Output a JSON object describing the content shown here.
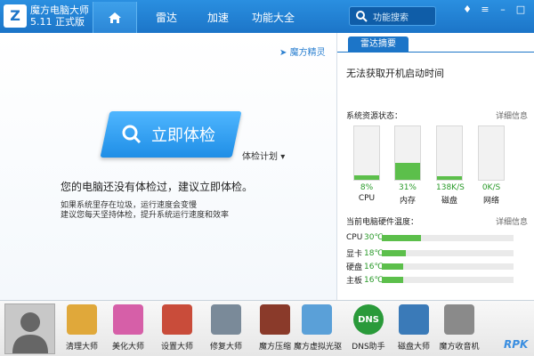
{
  "app": {
    "name": "魔方电脑大师",
    "version": "5.11 正式版"
  },
  "nav": {
    "tabs": [
      "雷达",
      "加速",
      "功能大全"
    ],
    "search_placeholder": "功能搜索"
  },
  "left": {
    "sprite_label": "魔方精灵",
    "check_button": "立即体检",
    "plan_label": "体检计划",
    "message": "您的电脑还没有体检过，建议立即体检。",
    "tip1": "如果系统里存在垃圾，运行速度会变慢",
    "tip2": "建议您每天坚持体检，提升系统运行速度和效率"
  },
  "right": {
    "tab": "雷达摘要",
    "boot_time": "无法获取开机启动时间",
    "resource_header": "系统资源状态：",
    "detail_link": "详细信息",
    "resources": [
      {
        "label": "CPU",
        "value": "8%",
        "level": 0.08
      },
      {
        "label": "内存",
        "value": "31%",
        "level": 0.31
      },
      {
        "label": "磁盘",
        "value": "138K/S",
        "level": 0.06
      },
      {
        "label": "网络",
        "value": "0K/S",
        "level": 0.0
      }
    ],
    "temp_header": "当前电脑硬件温度：",
    "temps": [
      {
        "name": "CPU",
        "value": "30℃",
        "level": 0.3
      },
      {
        "name": "显卡",
        "value": "18℃",
        "level": 0.18
      },
      {
        "name": "硬盘",
        "value": "16℃",
        "level": 0.16
      },
      {
        "name": "主板",
        "value": "16℃",
        "level": 0.16
      }
    ]
  },
  "tools": [
    {
      "label": "清理大师",
      "icon": "broom-icon",
      "color": "#e0a83a"
    },
    {
      "label": "美化大师",
      "icon": "brush-icon",
      "color": "#d65fa8"
    },
    {
      "label": "设置大师",
      "icon": "rocket-icon",
      "color": "#c94c3a"
    },
    {
      "label": "修复大师",
      "icon": "wrench-icon",
      "color": "#7a8a99"
    },
    {
      "label": "魔方压缩",
      "icon": "archive-icon",
      "color": "#8a3a2a"
    },
    {
      "label": "魔方虚拟光驱",
      "icon": "disc-icon",
      "color": "#5aa0d8"
    },
    {
      "label": "DNS助手",
      "icon": "dns-icon",
      "color": "#2a9a3a"
    },
    {
      "label": "磁盘大师",
      "icon": "disk-icon",
      "color": "#3a7ab8"
    },
    {
      "label": "魔方收音机",
      "icon": "radio-icon",
      "color": "#8a8a8a"
    }
  ],
  "watermark": "RPK"
}
